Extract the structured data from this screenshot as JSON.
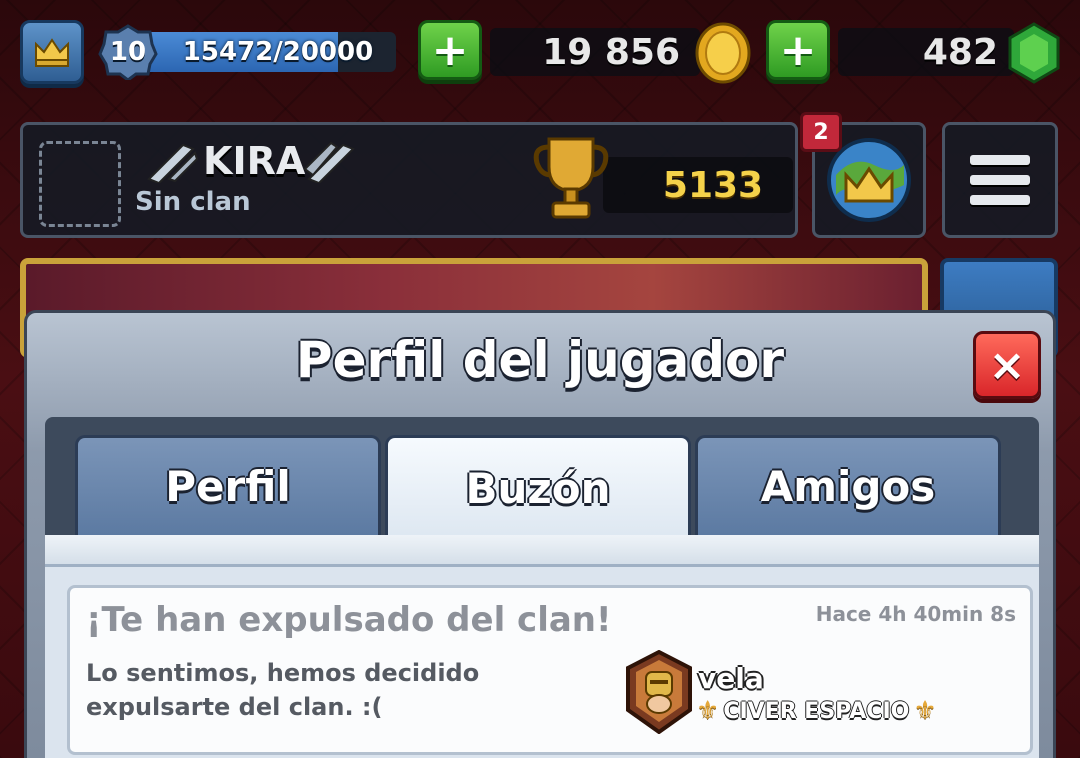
{
  "top_bar": {
    "level": "10",
    "xp_text": "15472/20000",
    "xp_fraction": 0.7736,
    "gold": "19 856",
    "gems": "482",
    "icons": {
      "crown": "crown-icon",
      "plus": "plus-icon",
      "gold": "gold-coin-icon",
      "gems": "gem-icon"
    }
  },
  "profile": {
    "player_name": "KIRA",
    "clan_status": "Sin clan",
    "trophies": "5133",
    "notification_count": "2"
  },
  "modal": {
    "title": "Perfil del jugador",
    "close_label": "×",
    "tabs": [
      {
        "label": "Perfil",
        "active": false
      },
      {
        "label": "Buzón",
        "active": true
      },
      {
        "label": "Amigos",
        "active": false
      }
    ]
  },
  "inbox": {
    "messages": [
      {
        "title": "¡Te han expulsado del clan!",
        "time": "Hace 4h 40min  8s",
        "body": "Lo sentimos, hemos decidido expulsarte del clan. :(",
        "sender_name": "vela",
        "sender_clan": "CIVER ESPACIO"
      }
    ]
  },
  "colors": {
    "accent_gold": "#f5d24a",
    "plus_green": "#2f9b23",
    "close_red": "#d9262a",
    "tab_blue": "#5c7aa2"
  }
}
